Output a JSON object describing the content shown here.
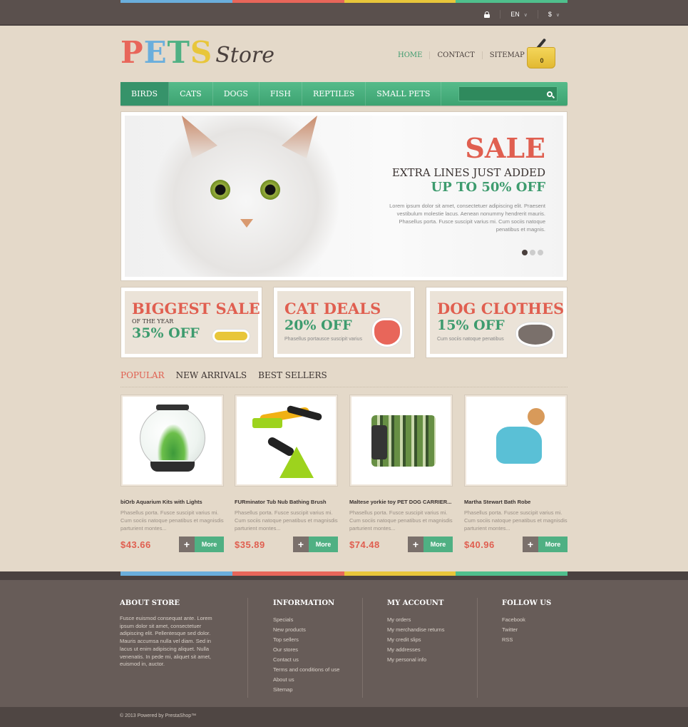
{
  "colors": {
    "blue": "#6aaedc",
    "red": "#e8665a",
    "yellow": "#e8c63a",
    "green": "#4fc08d",
    "accent_green": "#3d9b6e",
    "accent_red": "#e05f50"
  },
  "topbar": {
    "lock_icon": "lock-icon",
    "language": "EN",
    "currency": "$"
  },
  "logo": {
    "pets_letters": [
      "P",
      "E",
      "T",
      "S"
    ],
    "store": "Store"
  },
  "toplinks": [
    "HOME",
    "CONTACT",
    "SITEMAP"
  ],
  "cart": {
    "count": "0"
  },
  "nav": {
    "items": [
      "BIRDS",
      "CATS",
      "DOGS",
      "FISH",
      "REPTILES",
      "SMALL PETS"
    ],
    "active": "BIRDS",
    "search_placeholder": ""
  },
  "slider": {
    "title": "SALE",
    "subtitle": "EXTRA LINES JUST ADDED",
    "offer": "UP TO 50% OFF",
    "text": "Lorem ipsum dolor sit amet, consectetuer adipiscing elit. Praesent vestibulum molestie lacus. Aenean nonummy hendrerit mauris. Phasellus porta. Fusce suscipit varius mi. Cum sociis natoque penatibus et magnis.",
    "dots": 3,
    "active_dot": 1
  },
  "banners": [
    {
      "title": "BIGGEST SALE",
      "sub": "OF THE YEAR",
      "off": "35% OFF",
      "small": "",
      "icon": "bone-icon"
    },
    {
      "title": "CAT DEALS",
      "sub": "",
      "off": "20% OFF",
      "small": "Phasellus portausce suscipit varius",
      "icon": "cat-head-icon"
    },
    {
      "title": "DOG CLOTHES",
      "sub": "",
      "off": "15% OFF",
      "small": "Cum sociis natoque penatibus",
      "icon": "dog-head-icon"
    }
  ],
  "tabs": [
    "POPULAR",
    "NEW ARRIVALS",
    "BEST SELLERS"
  ],
  "products": [
    {
      "name": "biOrb Aquarium Kits with Lights",
      "desc": "Phasellus porta. Fusce suscipit varius mi. Cum sociis natoque penatibus et magnisdis parturient montes...",
      "price": "$43.66",
      "more": "More",
      "plus": "+"
    },
    {
      "name": "FURminator Tub Nub Bathing Brush",
      "desc": "Phasellus porta. Fusce suscipit varius mi. Cum sociis natoque penatibus et magnisdis parturient montes...",
      "price": "$35.89",
      "more": "More",
      "plus": "+"
    },
    {
      "name": "Maltese yorkie toy PET DOG CARRIER...",
      "desc": "Phasellus porta. Fusce suscipit varius mi. Cum sociis natoque penatibus et magnisdis parturient montes...",
      "price": "$74.48",
      "more": "More",
      "plus": "+"
    },
    {
      "name": "Martha Stewart Bath Robe",
      "desc": "Phasellus porta. Fusce suscipit varius mi. Cum sociis natoque penatibus et magnisdis parturient montes...",
      "price": "$40.96",
      "more": "More",
      "plus": "+"
    }
  ],
  "footer": {
    "about": {
      "title": "ABOUT STORE",
      "text": "Fusce euismod consequat ante. Lorem ipsum dolor sit amet, consectetuer adipiscing elit. Pellentesque sed dolor. Mauris accumsa nulla vel diam. Sed in lacus ut enim adipiscing aliquet. Nulla venenatis. In pede mi, aliquet sit amet, euismod in, auctor."
    },
    "information": {
      "title": "INFORMATION",
      "links": [
        "Specials",
        "New products",
        "Top sellers",
        "Our stores",
        "Contact us",
        "Terms and conditions of use",
        "About us",
        "Sitemap"
      ]
    },
    "account": {
      "title": "MY ACCOUNT",
      "links": [
        "My orders",
        "My merchandise returns",
        "My credit slips",
        "My addresses",
        "My personal info"
      ]
    },
    "follow": {
      "title": "FOLLOW US",
      "links": [
        "Facebook",
        "Twitter",
        "RSS"
      ]
    },
    "copyright": "© 2013 Powered by PrestaShop™"
  }
}
